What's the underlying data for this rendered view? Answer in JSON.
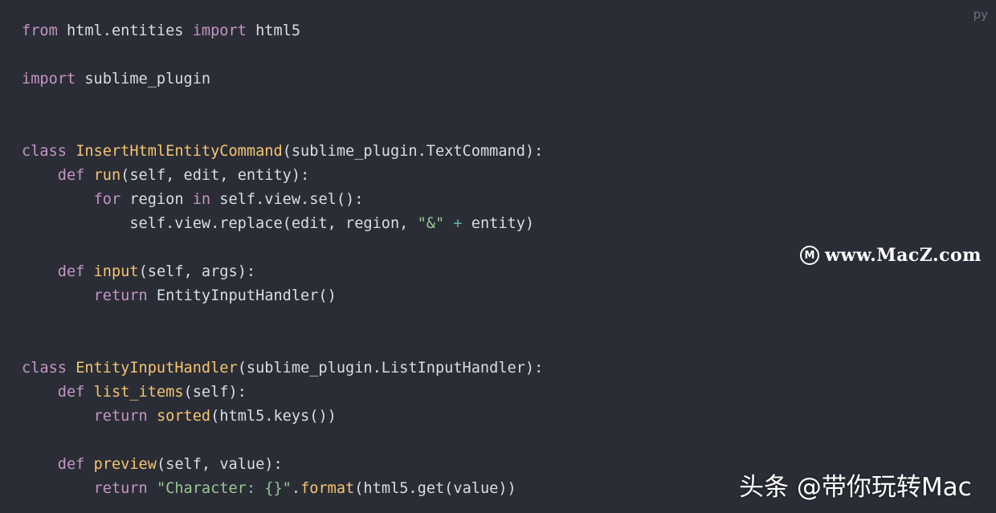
{
  "language_badge": "py",
  "code_lines": [
    [
      {
        "t": "from",
        "c": "kw"
      },
      {
        "t": " html.entities ",
        "c": "txt"
      },
      {
        "t": "import",
        "c": "kw"
      },
      {
        "t": " html5",
        "c": "txt"
      }
    ],
    [],
    [
      {
        "t": "import",
        "c": "kw"
      },
      {
        "t": " sublime_plugin",
        "c": "txt"
      }
    ],
    [],
    [],
    [
      {
        "t": "class",
        "c": "kw"
      },
      {
        "t": " ",
        "c": "txt"
      },
      {
        "t": "InsertHtmlEntityCommand",
        "c": "cls"
      },
      {
        "t": "(sublime_plugin.TextCommand):",
        "c": "txt"
      }
    ],
    [
      {
        "t": "    ",
        "c": "txt"
      },
      {
        "t": "def",
        "c": "kw"
      },
      {
        "t": " ",
        "c": "txt"
      },
      {
        "t": "run",
        "c": "fn"
      },
      {
        "t": "(self, edit, entity):",
        "c": "txt"
      }
    ],
    [
      {
        "t": "        ",
        "c": "txt"
      },
      {
        "t": "for",
        "c": "kw"
      },
      {
        "t": " region ",
        "c": "txt"
      },
      {
        "t": "in",
        "c": "kw"
      },
      {
        "t": " self.view.sel():",
        "c": "txt"
      }
    ],
    [
      {
        "t": "            self.view.replace(edit, region, ",
        "c": "txt"
      },
      {
        "t": "\"&\"",
        "c": "str"
      },
      {
        "t": " ",
        "c": "txt"
      },
      {
        "t": "+",
        "c": "op"
      },
      {
        "t": " entity)",
        "c": "txt"
      }
    ],
    [],
    [
      {
        "t": "    ",
        "c": "txt"
      },
      {
        "t": "def",
        "c": "kw"
      },
      {
        "t": " ",
        "c": "txt"
      },
      {
        "t": "input",
        "c": "fn"
      },
      {
        "t": "(self, args):",
        "c": "txt"
      }
    ],
    [
      {
        "t": "        ",
        "c": "txt"
      },
      {
        "t": "return",
        "c": "kw"
      },
      {
        "t": " EntityInputHandler()",
        "c": "txt"
      }
    ],
    [],
    [],
    [
      {
        "t": "class",
        "c": "kw"
      },
      {
        "t": " ",
        "c": "txt"
      },
      {
        "t": "EntityInputHandler",
        "c": "cls"
      },
      {
        "t": "(sublime_plugin.ListInputHandler):",
        "c": "txt"
      }
    ],
    [
      {
        "t": "    ",
        "c": "txt"
      },
      {
        "t": "def",
        "c": "kw"
      },
      {
        "t": " ",
        "c": "txt"
      },
      {
        "t": "list_items",
        "c": "fn"
      },
      {
        "t": "(self):",
        "c": "txt"
      }
    ],
    [
      {
        "t": "        ",
        "c": "txt"
      },
      {
        "t": "return",
        "c": "kw"
      },
      {
        "t": " ",
        "c": "txt"
      },
      {
        "t": "sorted",
        "c": "fn"
      },
      {
        "t": "(html5.keys())",
        "c": "txt"
      }
    ],
    [],
    [
      {
        "t": "    ",
        "c": "txt"
      },
      {
        "t": "def",
        "c": "kw"
      },
      {
        "t": " ",
        "c": "txt"
      },
      {
        "t": "preview",
        "c": "fn"
      },
      {
        "t": "(self, value):",
        "c": "txt"
      }
    ],
    [
      {
        "t": "        ",
        "c": "txt"
      },
      {
        "t": "return",
        "c": "kw"
      },
      {
        "t": " ",
        "c": "txt"
      },
      {
        "t": "\"Character: {}\"",
        "c": "str"
      },
      {
        "t": ".",
        "c": "txt"
      },
      {
        "t": "format",
        "c": "fn"
      },
      {
        "t": "(html5.get(value))",
        "c": "txt"
      }
    ]
  ],
  "watermark": {
    "site_logo_letter": "M",
    "site_text": "www.MacZ.com",
    "author_text": "头条 @带你玩转Mac"
  },
  "colors": {
    "background": "#2a2d36",
    "keyword": "#c594c5",
    "class_name": "#f5c56e",
    "string": "#99c794",
    "operator": "#5fb3b3",
    "text": "#d9dde4"
  }
}
